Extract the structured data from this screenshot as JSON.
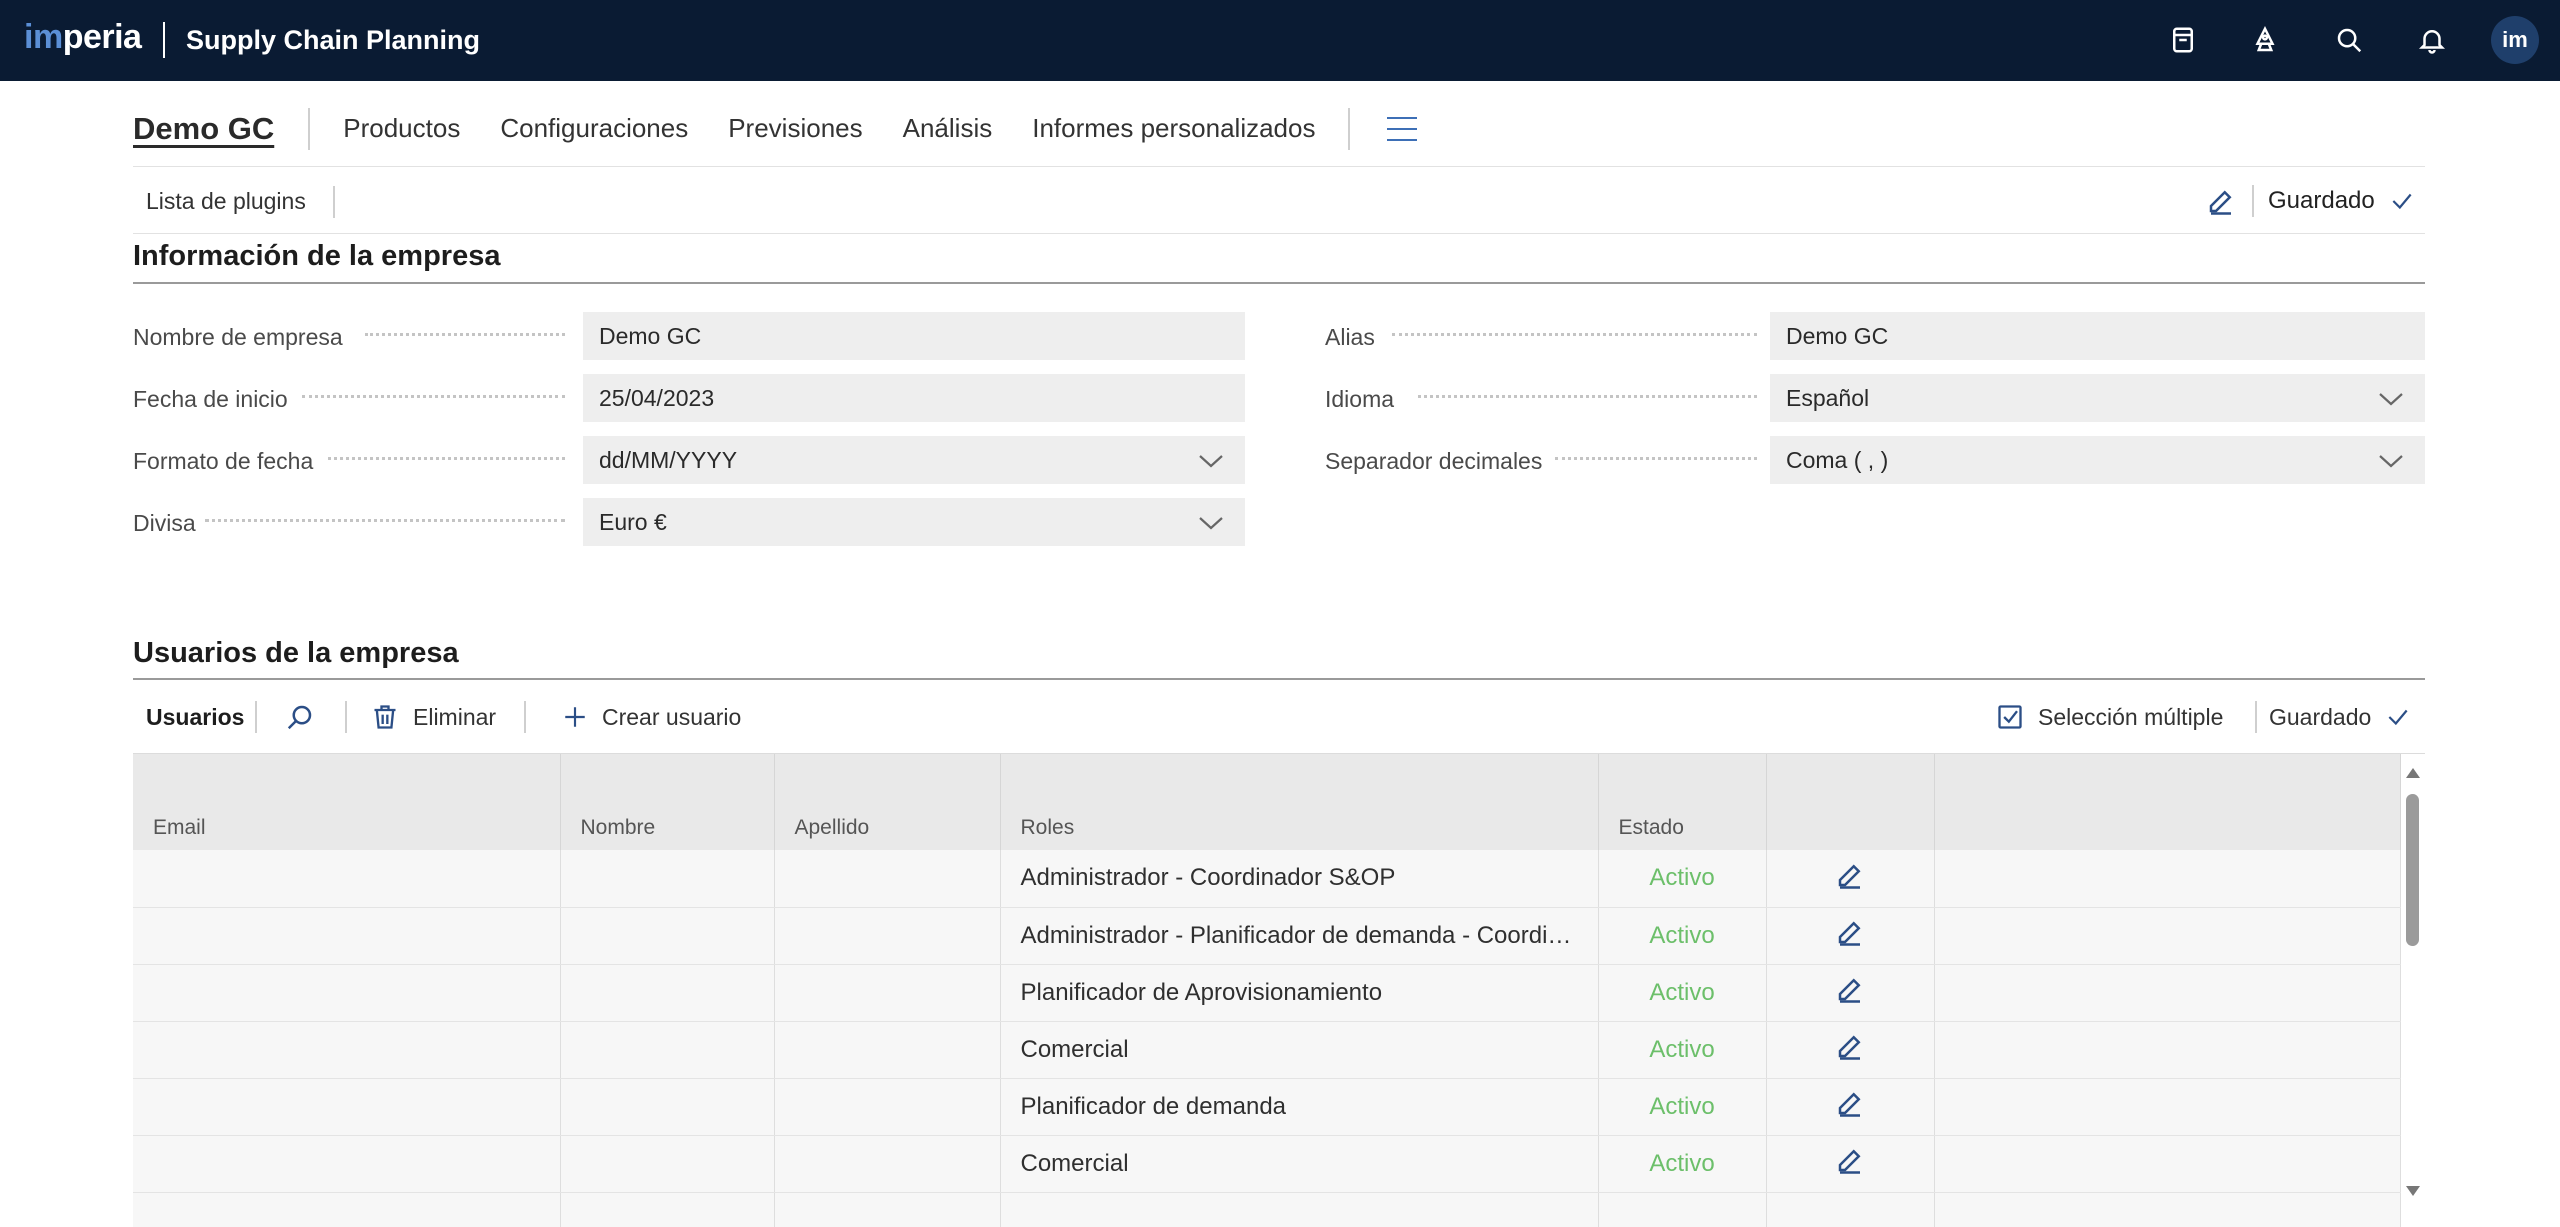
{
  "app": {
    "logo_im": "im",
    "logo_rest": "peria",
    "title": "Supply Chain Planning",
    "avatar_initials": "im",
    "top_icons": [
      "document-icon",
      "rocket-icon",
      "search-icon",
      "bell-icon"
    ]
  },
  "nav": {
    "company": "Demo GC",
    "links": [
      "Productos",
      "Configuraciones",
      "Previsiones",
      "Análisis",
      "Informes personalizados"
    ]
  },
  "plugins": {
    "link": "Lista de plugins",
    "saved_label": "Guardado"
  },
  "company_info": {
    "title": "Información de la empresa",
    "fields": {
      "nombre": {
        "label": "Nombre de empresa",
        "value": "Demo GC"
      },
      "fecha_inicio": {
        "label": "Fecha de inicio",
        "value": "25/04/2023"
      },
      "formato_fecha": {
        "label": "Formato de fecha",
        "value": "dd/MM/YYYY"
      },
      "divisa": {
        "label": "Divisa",
        "value": "Euro €"
      },
      "alias": {
        "label": "Alias",
        "value": "Demo GC"
      },
      "idioma": {
        "label": "Idioma",
        "value": "Español"
      },
      "separador": {
        "label": "Separador decimales",
        "value": "Coma ( , )"
      }
    }
  },
  "users": {
    "title": "Usuarios de la empresa",
    "toolbar": {
      "tab": "Usuarios",
      "delete": "Eliminar",
      "create": "Crear usuario",
      "multi_select": "Selección múltiple",
      "saved": "Guardado"
    },
    "columns": [
      "Email",
      "Nombre",
      "Apellido",
      "Roles",
      "Estado",
      "",
      ""
    ],
    "rows": [
      {
        "email": "",
        "nombre": "",
        "apellido": "",
        "roles": "Administrador - Coordinador S&OP",
        "estado": "Activo"
      },
      {
        "email": "",
        "nombre": "",
        "apellido": "",
        "roles": "Administrador - Planificador de demanda - Coordin...",
        "estado": "Activo"
      },
      {
        "email": "",
        "nombre": "",
        "apellido": "",
        "roles": "Planificador de Aprovisionamiento",
        "estado": "Activo"
      },
      {
        "email": "",
        "nombre": "",
        "apellido": "",
        "roles": "Comercial",
        "estado": "Activo"
      },
      {
        "email": "",
        "nombre": "",
        "apellido": "",
        "roles": "Planificador de demanda",
        "estado": "Activo"
      },
      {
        "email": "",
        "nombre": "",
        "apellido": "",
        "roles": "Comercial",
        "estado": "Activo"
      },
      {
        "email": "",
        "nombre": "",
        "apellido": "",
        "roles": "",
        "estado": ""
      }
    ]
  },
  "colors": {
    "topbar": "#0a1b33",
    "accent": "#2b4e86",
    "status_active": "#6cbf6a"
  }
}
